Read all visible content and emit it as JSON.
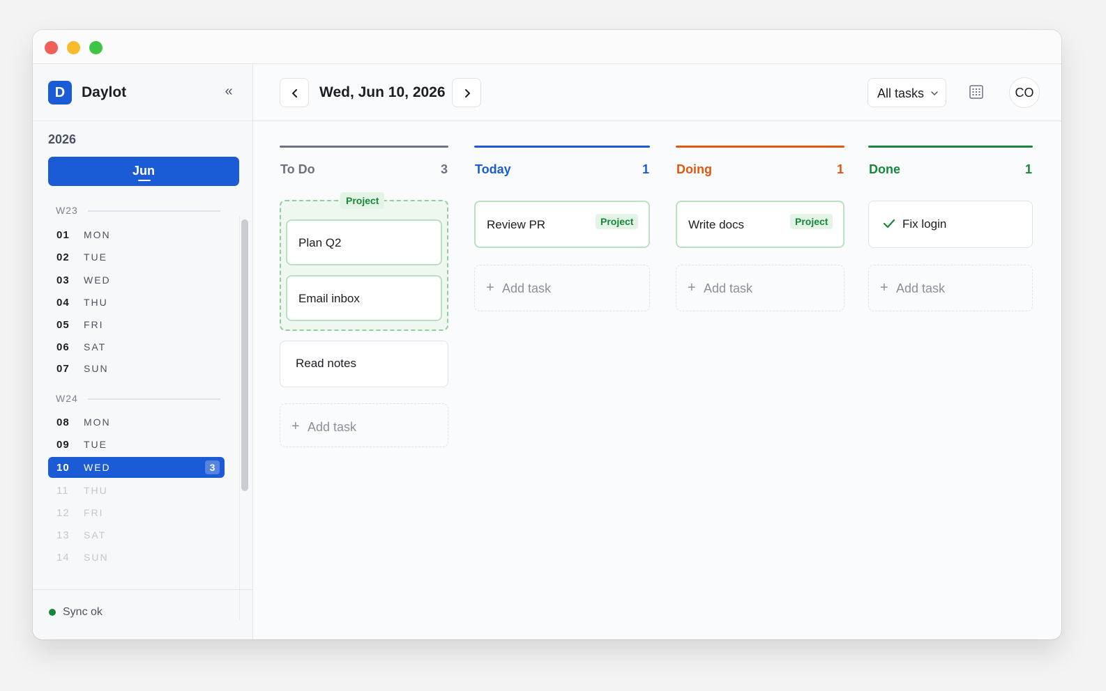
{
  "app": {
    "logo_letter": "D",
    "name": "Daylot",
    "collapse_icon": "chevrons-left-icon"
  },
  "sidebar": {
    "year": "2026",
    "month": "Jun",
    "weeks": [
      {
        "label": "W23",
        "days": [
          {
            "num": "01",
            "dow": "MON"
          },
          {
            "num": "02",
            "dow": "TUE"
          },
          {
            "num": "03",
            "dow": "WED"
          },
          {
            "num": "04",
            "dow": "THU"
          },
          {
            "num": "05",
            "dow": "FRI"
          },
          {
            "num": "06",
            "dow": "SAT"
          },
          {
            "num": "07",
            "dow": "SUN"
          }
        ]
      },
      {
        "label": "W24",
        "days": [
          {
            "num": "08",
            "dow": "MON"
          },
          {
            "num": "09",
            "dow": "TUE"
          },
          {
            "num": "10",
            "dow": "WED",
            "badge": "3",
            "selected": true
          },
          {
            "num": "11",
            "dow": "THU"
          },
          {
            "num": "12",
            "dow": "FRI"
          },
          {
            "num": "13",
            "dow": "SAT"
          },
          {
            "num": "14",
            "dow": "SUN"
          }
        ]
      }
    ],
    "sync_status": "Sync ok"
  },
  "toolbar": {
    "date": "Wed, Jun 10, 2026",
    "filter": "All tasks",
    "avatar": "CO"
  },
  "columns": [
    {
      "title": "To Do",
      "count": "3",
      "color": "#6b7280",
      "group_tag": "Project",
      "cards": [
        {
          "title": "Plan Q2"
        },
        {
          "title": "Email inbox"
        },
        {
          "title": "Read notes"
        }
      ],
      "add_label": "Add task"
    },
    {
      "title": "Today",
      "count": "1",
      "color": "#1c5bd6",
      "cards": [
        {
          "title": "Review PR",
          "tag": "Project"
        }
      ],
      "add_label": "Add task"
    },
    {
      "title": "Doing",
      "count": "1",
      "color": "#e0570f",
      "cards": [
        {
          "title": "Write docs",
          "tag": "Project"
        }
      ],
      "add_label": "Add task"
    },
    {
      "title": "Done",
      "count": "1",
      "color": "#17873a",
      "cards": [
        {
          "title": "Fix login",
          "done": true
        }
      ],
      "add_label": "Add task"
    }
  ],
  "colors": {
    "accent": "#1c5bd6",
    "success": "#17873a",
    "warning": "#e0570f",
    "muted": "#6b7280"
  }
}
